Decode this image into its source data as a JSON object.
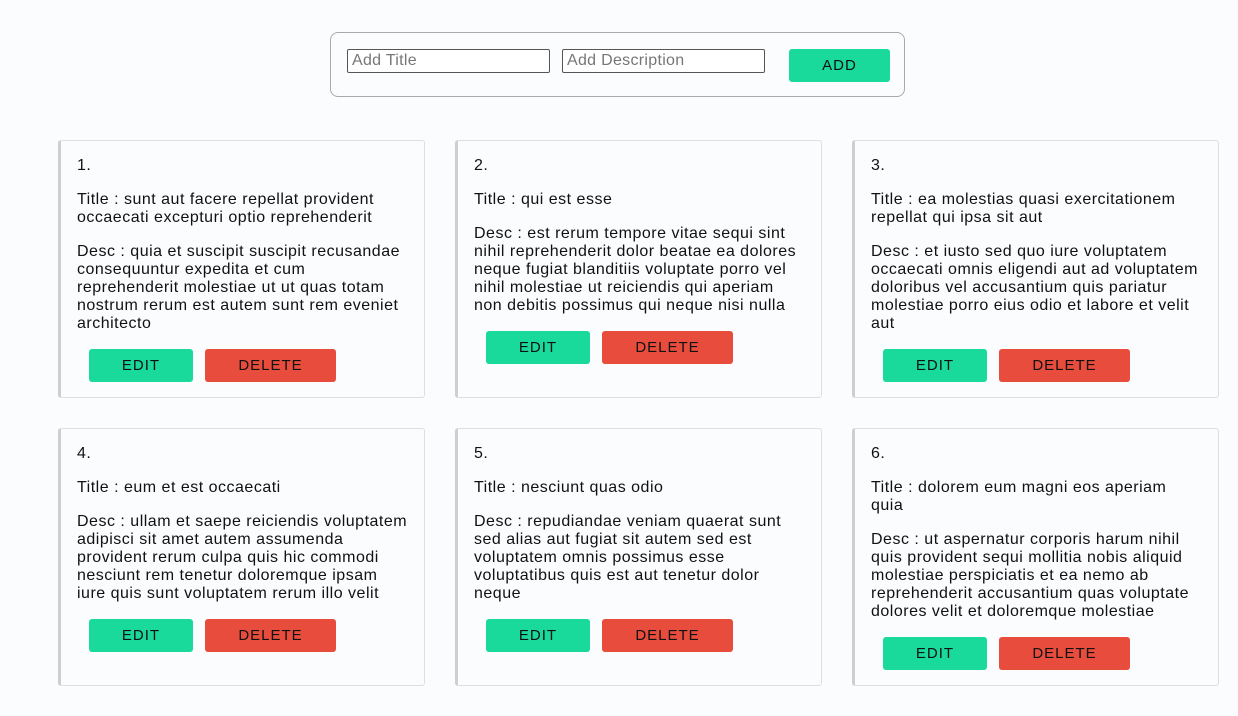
{
  "form": {
    "title_placeholder": "Add Title",
    "desc_placeholder": "Add Description",
    "add_label": "ADD"
  },
  "colors": {
    "add": "#19d99b",
    "edit": "#19d99b",
    "delete": "#e74c3c"
  },
  "cards": [
    {
      "num": "1.",
      "title": "Title : sunt aut facere repellat provident occaecati excepturi optio reprehenderit",
      "desc": "Desc : quia et suscipit suscipit recusandae consequuntur expedita et cum reprehenderit molestiae ut ut quas totam nostrum rerum est autem sunt rem eveniet architecto",
      "edit_label": "EDIT",
      "delete_label": "DELETE"
    },
    {
      "num": "2.",
      "title": "Title : qui est esse",
      "desc": "Desc : est rerum tempore vitae sequi sint nihil reprehenderit dolor beatae ea dolores neque fugiat blanditiis voluptate porro vel nihil molestiae ut reiciendis qui aperiam non debitis possimus qui neque nisi nulla",
      "edit_label": "EDIT",
      "delete_label": "DELETE"
    },
    {
      "num": "3.",
      "title": "Title : ea molestias quasi exercitationem repellat qui ipsa sit aut",
      "desc": "Desc : et iusto sed quo iure voluptatem occaecati omnis eligendi aut ad voluptatem doloribus vel accusantium quis pariatur molestiae porro eius odio et labore et velit aut",
      "edit_label": "EDIT",
      "delete_label": "DELETE"
    },
    {
      "num": "4.",
      "title": "Title : eum et est occaecati",
      "desc": "Desc : ullam et saepe reiciendis voluptatem adipisci sit amet autem assumenda provident rerum culpa quis hic commodi nesciunt rem tenetur doloremque ipsam iure quis sunt voluptatem rerum illo velit",
      "edit_label": "EDIT",
      "delete_label": "DELETE"
    },
    {
      "num": "5.",
      "title": "Title : nesciunt quas odio",
      "desc": "Desc : repudiandae veniam quaerat sunt sed alias aut fugiat sit autem sed est voluptatem omnis possimus esse voluptatibus quis est aut tenetur dolor neque",
      "edit_label": "EDIT",
      "delete_label": "DELETE"
    },
    {
      "num": "6.",
      "title": "Title : dolorem eum magni eos aperiam quia",
      "desc": "Desc : ut aspernatur corporis harum nihil quis provident sequi mollitia nobis aliquid molestiae perspiciatis et ea nemo ab reprehenderit accusantium quas voluptate dolores velit et doloremque molestiae",
      "edit_label": "EDIT",
      "delete_label": "DELETE"
    }
  ]
}
